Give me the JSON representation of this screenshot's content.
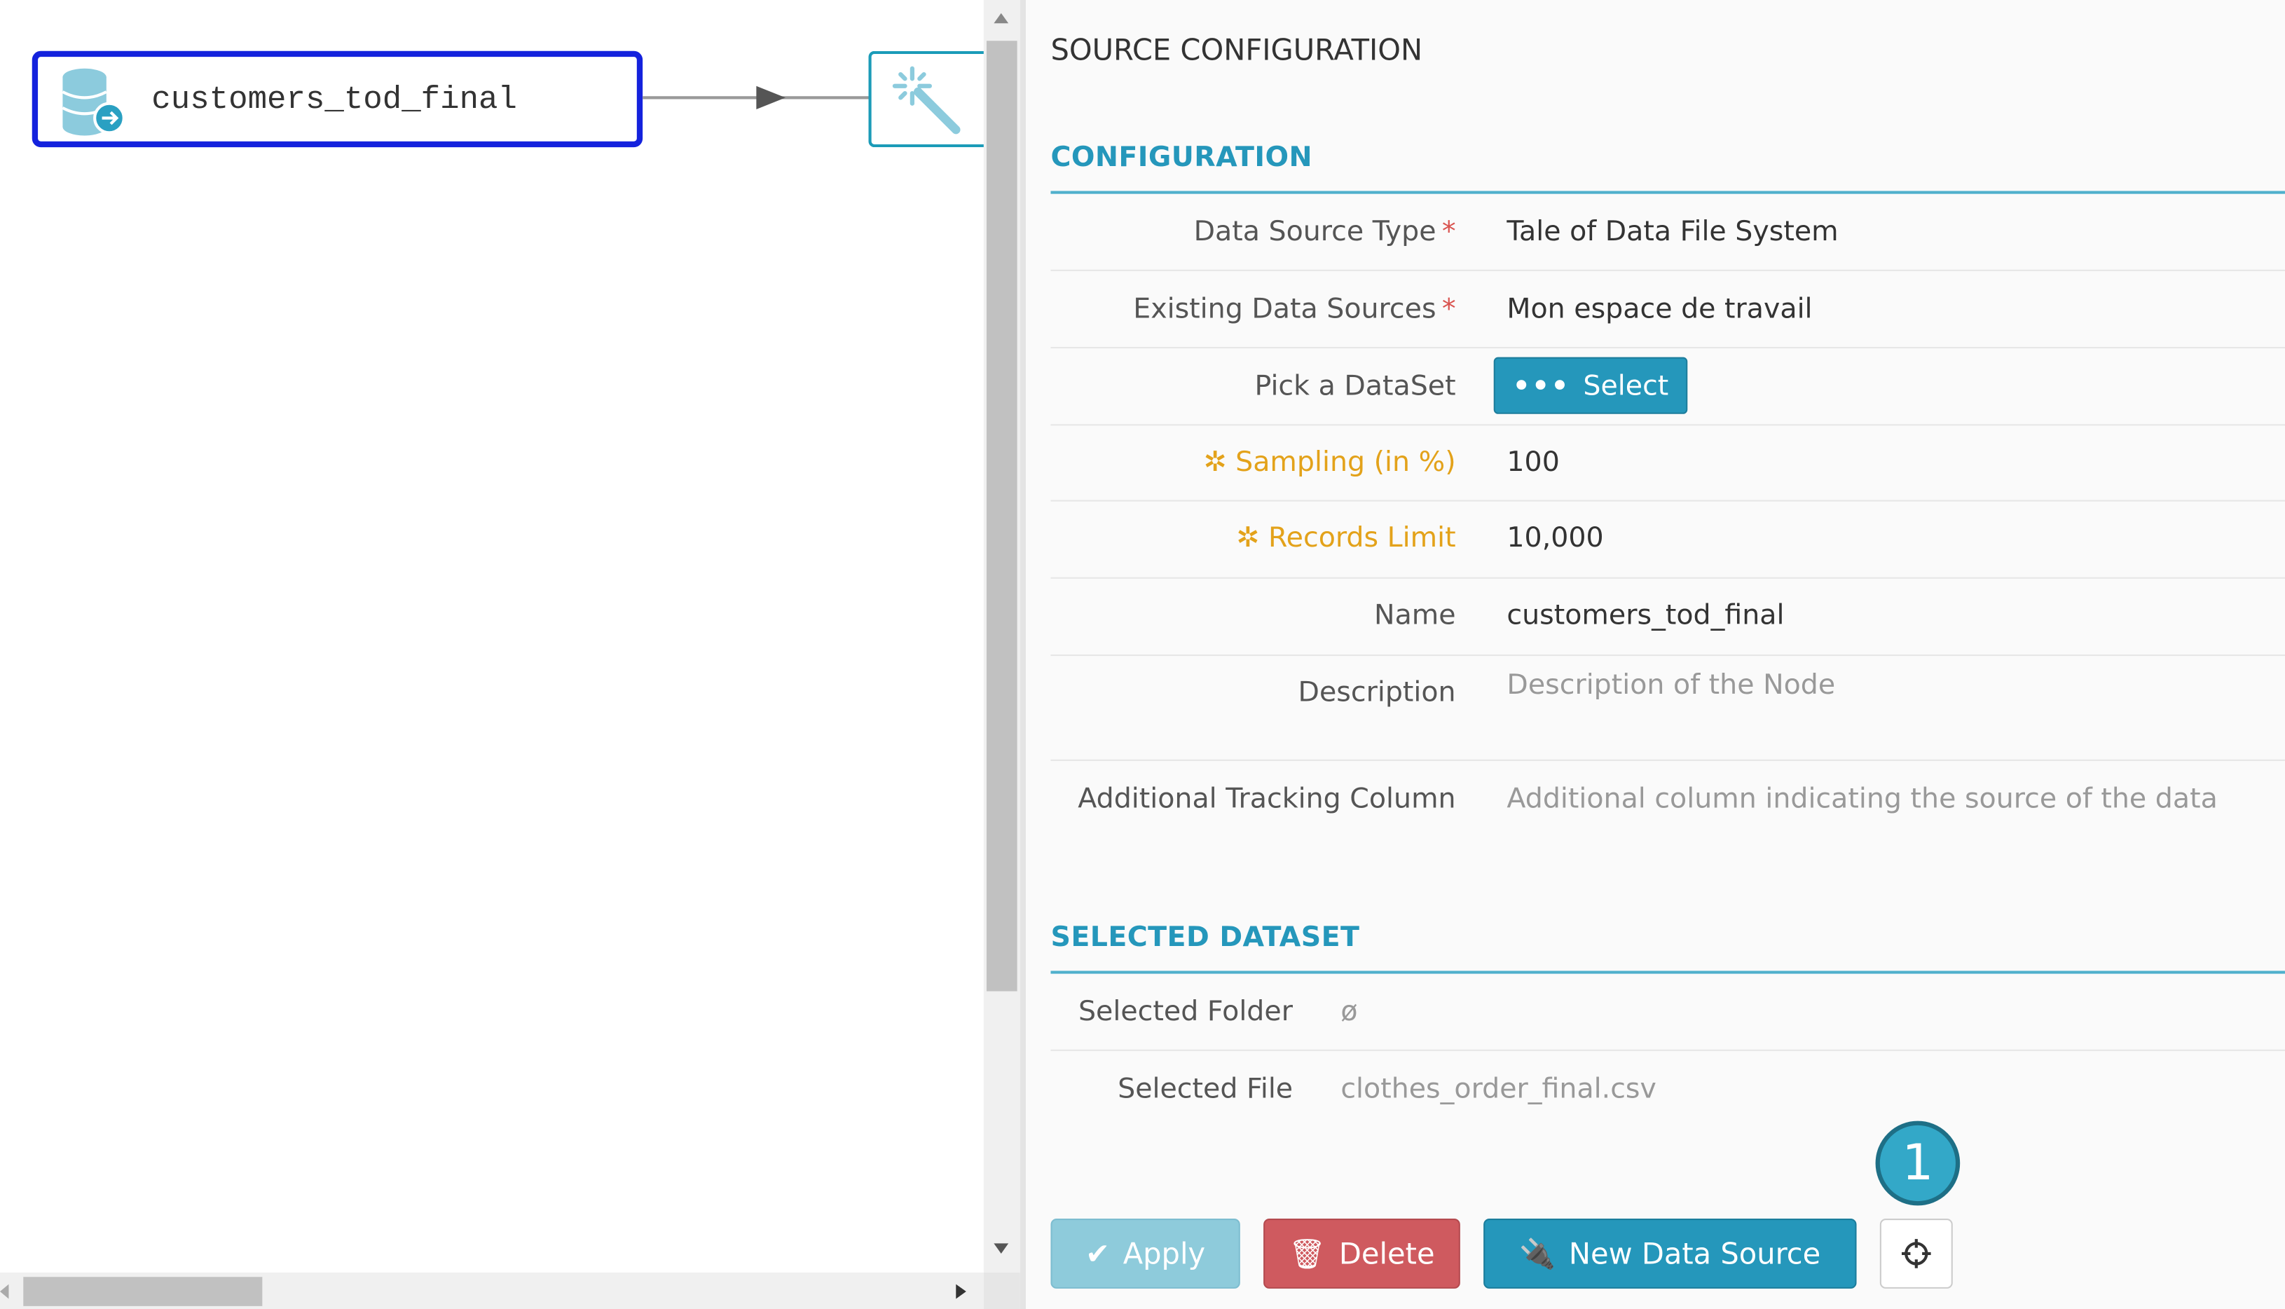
{
  "canvas": {
    "source_node": {
      "label": "customers_tod_final",
      "icon": "database-export-icon"
    },
    "next_node": {
      "icon": "magic-wand-icon"
    }
  },
  "panel": {
    "title": "SOURCE CONFIGURATION",
    "configuration": {
      "heading": "CONFIGURATION",
      "rows": [
        {
          "label": "Data Source Type",
          "required": "*",
          "value": "Tale of Data File System"
        },
        {
          "label": "Existing Data Sources",
          "required": "*",
          "value": "Mon espace de travail"
        },
        {
          "label": "Pick a DataSet",
          "button": "Select"
        },
        {
          "label": "Sampling (in %)",
          "value": "100",
          "icon": "network-icon"
        },
        {
          "label": "Records Limit",
          "value": "10,000",
          "icon": "network-icon"
        },
        {
          "label": "Name",
          "value": "customers_tod_final"
        },
        {
          "label": "Description",
          "placeholder": "Description of the Node"
        },
        {
          "label": "Additional Tracking Column",
          "placeholder": "Additional column indicating the source of the data"
        }
      ]
    },
    "selected_dataset": {
      "heading": "SELECTED DATASET",
      "folder_label": "Selected Folder",
      "folder_value": "ø",
      "file_label": "Selected File",
      "file_value": "clothes_order_final.csv"
    },
    "buttons": {
      "apply": "Apply",
      "delete": "Delete",
      "new_source": "New Data Source"
    },
    "badge": "1"
  },
  "colors": {
    "accent": "#2597bb",
    "danger": "#d0575c",
    "warning": "#e3a21a",
    "selected_node": "#1422dd"
  }
}
